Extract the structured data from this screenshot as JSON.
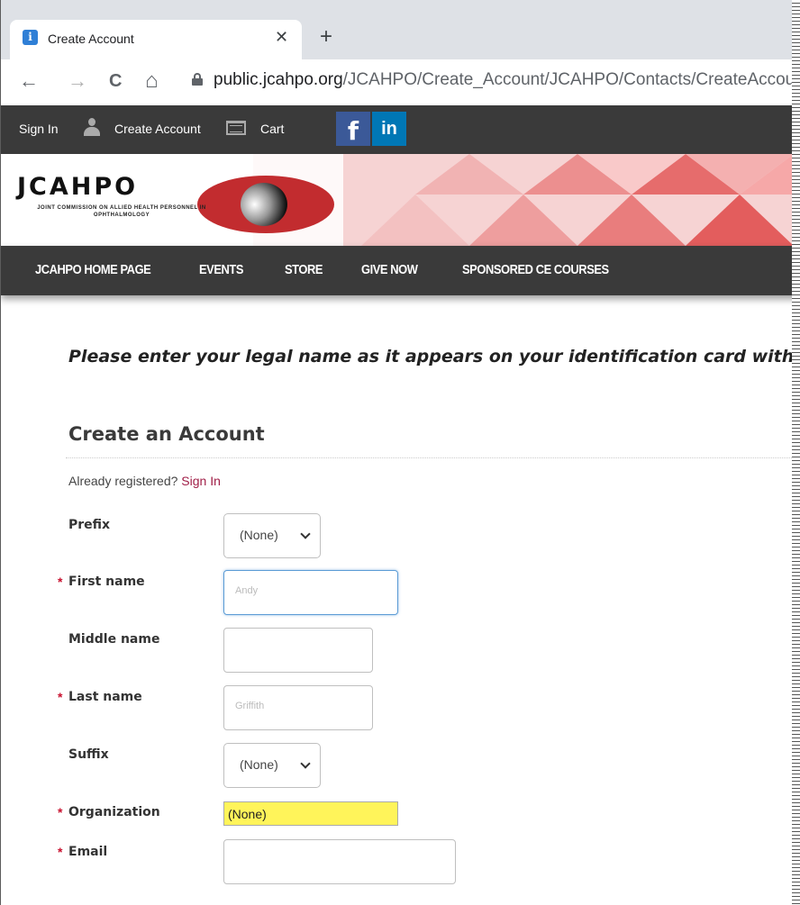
{
  "browser": {
    "tab_title": "Create Account",
    "tab_close": "✕",
    "new_tab": "+",
    "back": "←",
    "forward": "→",
    "reload": "C",
    "home": "⌂",
    "url_domain": "public.jcahpo.org",
    "url_path": "/JCAHPO/Create_Account/JCAHPO/Contacts/CreateAccount.as"
  },
  "topbar": {
    "sign_in": "Sign In",
    "create_account": "Create Account",
    "cart": "Cart",
    "facebook": "f",
    "linkedin": "in"
  },
  "logo": {
    "name": "JCAHPO",
    "subtitle": "JOINT COMMISSION ON ALLIED HEALTH PERSONNEL IN OPHTHALMOLOGY"
  },
  "main_nav": [
    "JCAHPO HOME PAGE",
    "EVENTS",
    "STORE",
    "GIVE NOW",
    "SPONSORED CE COURSES"
  ],
  "form": {
    "notice": "Please enter your legal name as it appears on your identification card with pr",
    "heading": "Create an Account",
    "already_text": "Already registered? ",
    "sign_in_link": "Sign In",
    "required_mark": "*",
    "prefix_label": "Prefix",
    "prefix_value": "(None)",
    "first_name_label": "First name",
    "first_name_value": "Andy",
    "middle_name_label": "Middle name",
    "middle_name_value": "",
    "last_name_label": "Last name",
    "last_name_value": "Griffith",
    "suffix_label": "Suffix",
    "suffix_value": "(None)",
    "organization_label": "Organization",
    "organization_value": "(None)",
    "email_label": "Email",
    "email_value": ""
  },
  "colors": {
    "topbar_bg": "#3a3a3a",
    "link": "#a01e47",
    "required": "#c8102e",
    "highlight": "#fff45a",
    "logo_red": "#c22c2f"
  }
}
